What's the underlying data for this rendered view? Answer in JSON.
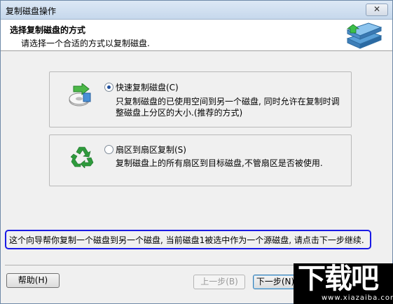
{
  "window": {
    "title": "复制磁盘操作",
    "close_symbol": "✕"
  },
  "header": {
    "title": "选择复制磁盘的方式",
    "subtitle": "请选择一个合适的方式以复制磁盘.",
    "icon": "disk-copy-icon"
  },
  "options": [
    {
      "label": "快速复制磁盘(C)",
      "selected": true,
      "description_line1": "只复制磁盘的已使用空间到另一个磁盘, 同时允许在复制时调",
      "description_line2": "整磁盘上分区的大小.(推荐的方式)",
      "icon": "disk-green-arrow-icon"
    },
    {
      "label": "扇区到扇区复制(S)",
      "selected": false,
      "description_line1": "复制磁盘上的所有扇区到目标磁盘,不管扇区是否被使用.",
      "icon": "recycle-icon"
    }
  ],
  "notice": "这个向导帮你复制一个磁盘到另一个磁盘, 当前磁盘1被选中作为一个源磁盘, 请点击下一步继续.",
  "buttons": {
    "help": "帮助(H)",
    "back": "上一步(B)",
    "next": "下一步(N)"
  },
  "watermark": {
    "main": "下载吧",
    "sub": "www.xiazaiba.com"
  },
  "colors": {
    "notice_border": "#1a1ae6",
    "recycle_green": "#2e9a3c",
    "radio_dot": "#1f4e9c"
  }
}
